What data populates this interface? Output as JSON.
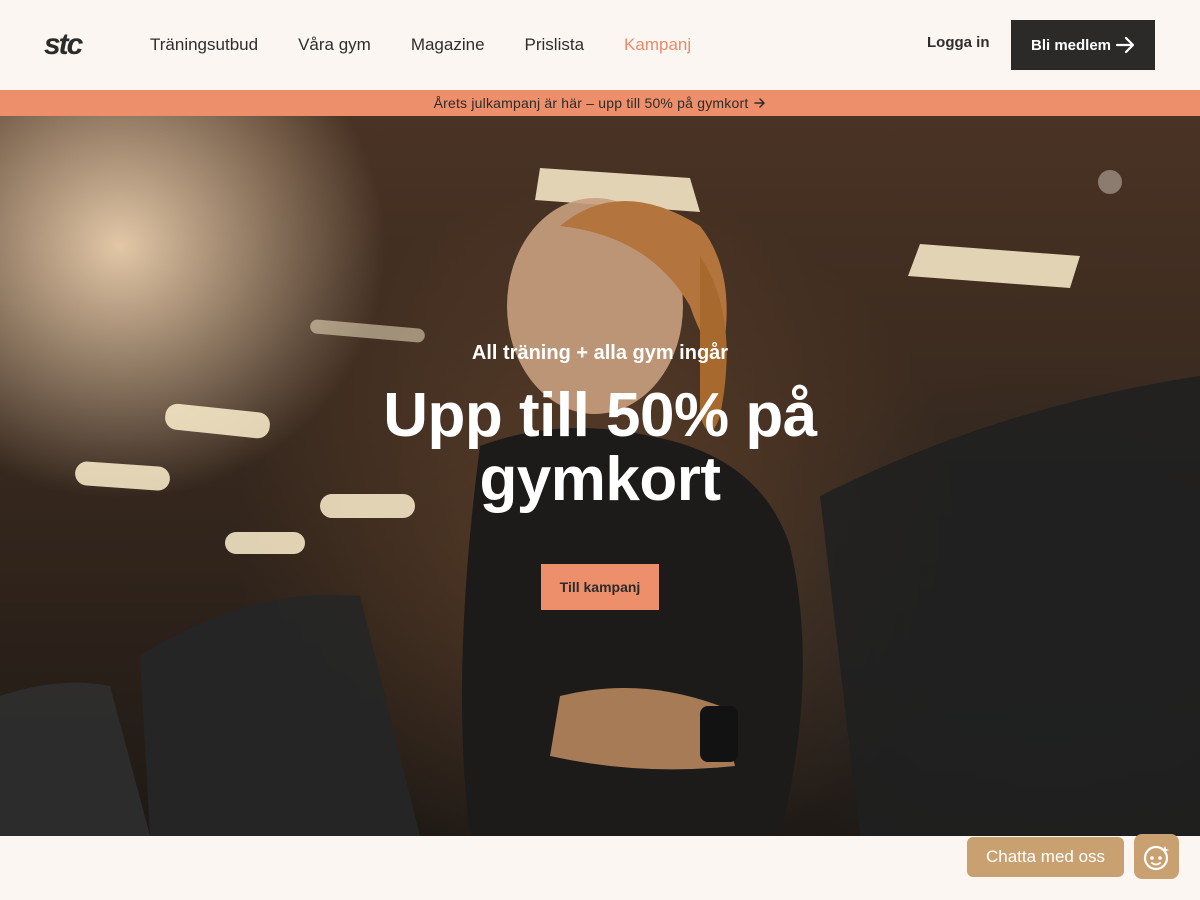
{
  "brand": {
    "logo_text": "stc"
  },
  "nav": {
    "items": [
      {
        "label": "Träningsutbud"
      },
      {
        "label": "Våra gym"
      },
      {
        "label": "Magazine"
      },
      {
        "label": "Prislista"
      },
      {
        "label": "Kampanj",
        "active": true
      }
    ],
    "login_label": "Logga in",
    "join_label": "Bli medlem"
  },
  "promo": {
    "text": "Årets julkampanj är här – upp till 50% på gymkort"
  },
  "hero": {
    "subtitle": "All träning + alla gym ingår",
    "title": "Upp till 50% på gymkort",
    "cta_label": "Till kampanj"
  },
  "chat": {
    "label": "Chatta med oss"
  },
  "colors": {
    "accent": "#ee8f6c",
    "dark": "#2b2a29",
    "background": "#fbf6f1",
    "chat": "#c9a171"
  },
  "icons": [
    "arrow-right-icon",
    "chat-avatar-icon"
  ]
}
